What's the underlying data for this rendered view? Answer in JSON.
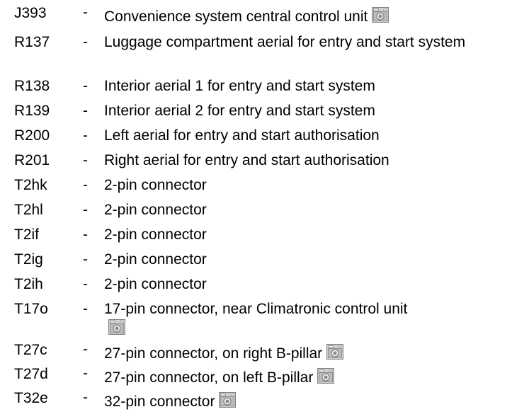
{
  "legend": {
    "items": [
      {
        "code": "J393",
        "dash": "-",
        "description": "Convenience system central control unit",
        "icon": "camera-icon"
      },
      {
        "code": "R137",
        "dash": "-",
        "description": "Luggage compartment aerial for entry and start system"
      },
      {
        "code": "R138",
        "dash": "-",
        "description": "Interior aerial 1 for entry and start system"
      },
      {
        "code": "R139",
        "dash": "-",
        "description": "Interior aerial 2 for entry and start system"
      },
      {
        "code": "R200",
        "dash": "-",
        "description": "Left aerial for entry and start authorisation"
      },
      {
        "code": "R201",
        "dash": "-",
        "description": "Right aerial for entry and start authorisation"
      },
      {
        "code": "T2hk",
        "dash": "-",
        "description": "2-pin connector"
      },
      {
        "code": "T2hl",
        "dash": "-",
        "description": "2-pin connector"
      },
      {
        "code": "T2if",
        "dash": "-",
        "description": "2-pin connector"
      },
      {
        "code": "T2ig",
        "dash": "-",
        "description": "2-pin connector"
      },
      {
        "code": "T2ih",
        "dash": "-",
        "description": "2-pin connector"
      },
      {
        "code": "T17o",
        "dash": "-",
        "description": "17-pin connector, near Climatronic control unit",
        "icon": "camera-icon"
      },
      {
        "code": "T27c",
        "dash": "-",
        "description": "27-pin connector, on right B-pillar",
        "icon": "camera-icon"
      },
      {
        "code": "T27d",
        "dash": "-",
        "description": "27-pin connector, on left B-pillar",
        "icon": "camera-icon"
      },
      {
        "code": "T32e",
        "dash": "-",
        "description": "32-pin connector",
        "icon": "camera-icon"
      }
    ]
  }
}
